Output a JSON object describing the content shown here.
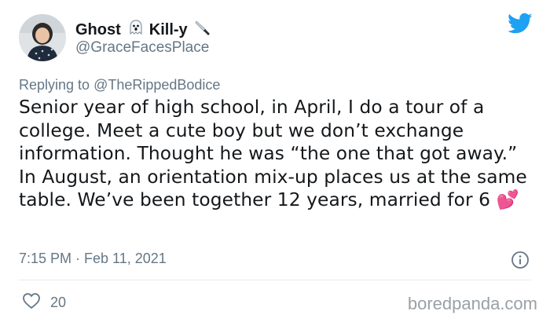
{
  "tweet": {
    "display_name_parts": [
      "Ghost",
      "Kill-y"
    ],
    "handle": "@GraceFacesPlace",
    "replying_prefix": "Replying to",
    "replying_to": "@TheRippedBodice",
    "text": "Senior year of high school, in April, I do a tour of a college. Meet a cute boy but we don’t exchange information. Thought he was “the one that got away.” In August, an orientation mix-up places us at the same table. We’ve been together 12 years, married for 6",
    "emoji": "💕",
    "timestamp": "7:15 PM · Feb 11, 2021",
    "likes": "20"
  },
  "watermark": "boredpanda.com",
  "icons": {
    "name_emoji_1": "ghost-icon",
    "name_emoji_2": "knife-icon",
    "brand": "twitter-bird-icon",
    "info": "info-icon",
    "like": "heart-outline-icon"
  },
  "colors": {
    "twitter_blue": "#1da1f2",
    "secondary_text": "#657786",
    "heart_emoji": "#e0245e"
  }
}
